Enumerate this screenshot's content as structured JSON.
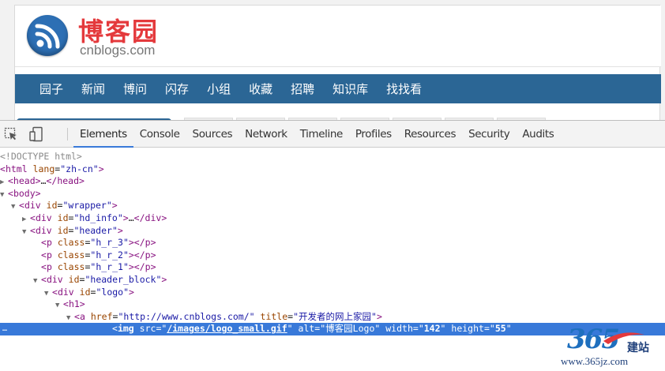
{
  "site": {
    "logo_cn": "博客园",
    "logo_en": "cnblogs.com",
    "nav": [
      "园子",
      "新闻",
      "博问",
      "闪存",
      "小组",
      "收藏",
      "招聘",
      "知识库",
      "找找看"
    ]
  },
  "devtools": {
    "tabs": [
      "Elements",
      "Console",
      "Sources",
      "Network",
      "Timeline",
      "Profiles",
      "Resources",
      "Security",
      "Audits"
    ],
    "active_tab": "Elements",
    "tree": {
      "doctype": "<!DOCTYPE html>",
      "html_tag": "html",
      "html_lang_attr": "lang",
      "html_lang_val": "zh-cn",
      "head_open": "<head>",
      "head_ellipsis": "…",
      "head_close": "</head>",
      "body": "body",
      "div": "div",
      "id_attr": "id",
      "class_attr": "class",
      "wrapper": "wrapper",
      "hd_info": "hd_info",
      "div_ellipsis": "…",
      "header": "header",
      "p": "p",
      "h_r_3": "h_r_3",
      "h_r_2": "h_r_2",
      "h_r_1": "h_r_1",
      "header_block": "header_block",
      "logo": "logo",
      "h1": "h1",
      "a": "a",
      "href_attr": "href",
      "href_val": "http://www.cnblogs.com/",
      "title_attr": "title",
      "title_val": "开发者的网上家园",
      "img": "img",
      "src_attr": "src",
      "src_val": "/images/logo_small.gif",
      "alt_attr": "alt",
      "alt_val": "博客园Logo",
      "width_attr": "width",
      "width_val": "142",
      "height_attr": "height",
      "height_val": "55",
      "selected_marker": "…"
    }
  },
  "watermark": {
    "number": "365",
    "cn": "建站",
    "url": "www.365jz.com"
  },
  "colors": {
    "nav_bg": "#2b6695",
    "logo_red": "#e4393c",
    "selected_row": "#3879d9",
    "tag": "#881280",
    "attr_name": "#994500",
    "attr_value": "#1a1aa6"
  }
}
